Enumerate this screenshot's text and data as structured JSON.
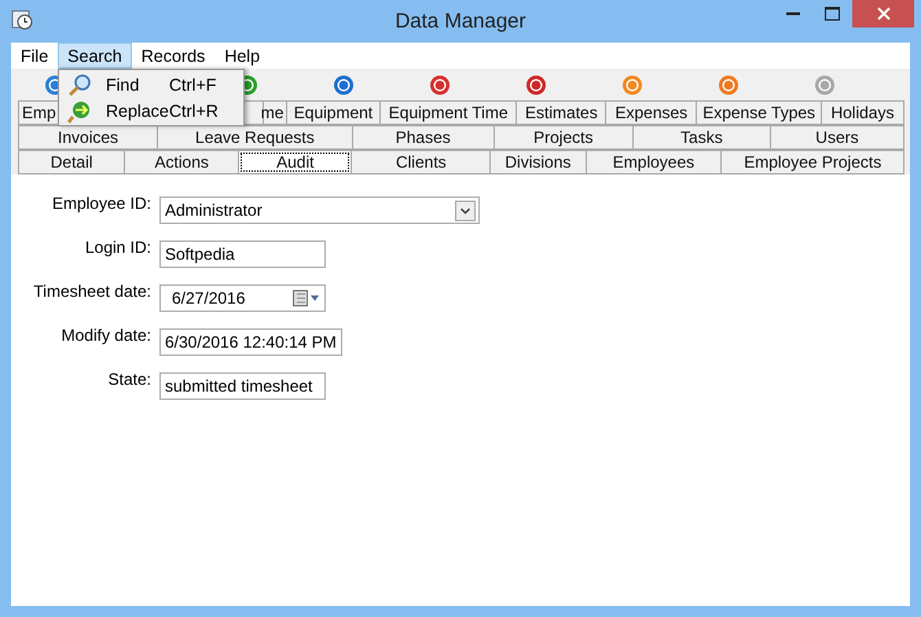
{
  "window": {
    "title": "Data Manager"
  },
  "menu_bar": [
    {
      "label": "File",
      "selected": false
    },
    {
      "label": "Search",
      "selected": true
    },
    {
      "label": "Records",
      "selected": false
    },
    {
      "label": "Help",
      "selected": false
    }
  ],
  "search_menu": [
    {
      "label": "Find",
      "shortcut": "Ctrl+F",
      "kind": "find"
    },
    {
      "label": "Replace",
      "shortcut": "Ctrl+R",
      "kind": "replace"
    }
  ],
  "toolbar": [
    {
      "kind": "info"
    },
    {
      "kind": "hidden"
    },
    {
      "kind": "play"
    },
    {
      "kind": "next"
    },
    {
      "kind": "stop"
    },
    {
      "kind": "remove"
    },
    {
      "kind": "accept"
    },
    {
      "kind": "cancel"
    },
    {
      "kind": "done"
    }
  ],
  "tab_rows": [
    [
      {
        "label": "Emp",
        "selected": false
      },
      {
        "label": "me",
        "selected": false
      },
      {
        "label": "Equipment",
        "selected": false
      },
      {
        "label": "Equipment Time",
        "selected": false
      },
      {
        "label": "Estimates",
        "selected": false
      },
      {
        "label": "Expenses",
        "selected": false
      },
      {
        "label": "Expense Types",
        "selected": false
      },
      {
        "label": "Holidays",
        "selected": false
      }
    ],
    [
      {
        "label": "Invoices",
        "selected": false
      },
      {
        "label": "Leave Requests",
        "selected": false
      },
      {
        "label": "Phases",
        "selected": false
      },
      {
        "label": "Projects",
        "selected": false
      },
      {
        "label": "Tasks",
        "selected": false
      },
      {
        "label": "Users",
        "selected": false
      }
    ],
    [
      {
        "label": "Detail",
        "selected": false
      },
      {
        "label": "Actions",
        "selected": false
      },
      {
        "label": "Audit",
        "selected": true
      },
      {
        "label": "Clients",
        "selected": false
      },
      {
        "label": "Divisions",
        "selected": false
      },
      {
        "label": "Employees",
        "selected": false
      },
      {
        "label": "Employee Projects",
        "selected": false
      }
    ]
  ],
  "fields": [
    {
      "label": "Employee ID:",
      "value": "Administrator",
      "kind": "combo"
    },
    {
      "label": "Login ID:",
      "value": "Softpedia",
      "kind": "text"
    },
    {
      "label": "Timesheet date:",
      "value": "6/27/2016",
      "kind": "date"
    },
    {
      "label": "Modify date:",
      "value": "6/30/2016 12:40:14 PM",
      "kind": "text"
    },
    {
      "label": "State:",
      "value": "submitted timesheet",
      "kind": "text"
    }
  ]
}
